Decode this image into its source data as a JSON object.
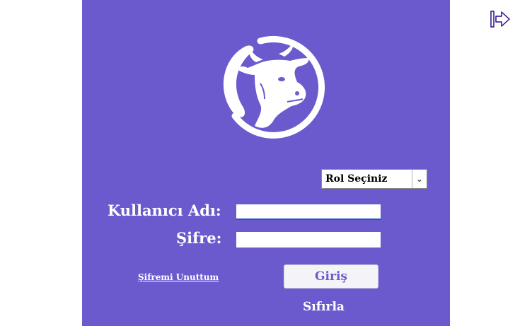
{
  "login": {
    "role_select": {
      "selected": "Rol Seçiniz"
    },
    "username_label": "Kullanıcı Adı:",
    "username_value": "",
    "password_label": "Şifre:",
    "password_value": "",
    "forgot_link": "Şifremi Unuttum",
    "login_button": "Giriş",
    "reset_button": "Sıfırla"
  },
  "icons": {
    "logo": "cow-head-logo-icon",
    "exit": "exit-arrow-icon",
    "dropdown": "chevron-down-icon"
  },
  "colors": {
    "panel": "#6a5acd",
    "text": "#ffffff",
    "accent": "#1a56c7",
    "exit_icon": "#2a0a8c"
  }
}
